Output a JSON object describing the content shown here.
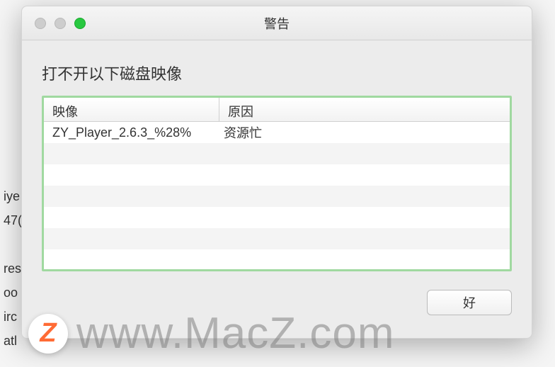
{
  "window": {
    "title": "警告"
  },
  "message": "打不开以下磁盘映像",
  "table": {
    "header": {
      "image": "映像",
      "reason": "原因"
    },
    "rows": [
      {
        "image": "ZY_Player_2.6.3_%28%",
        "reason": "资源忙"
      }
    ]
  },
  "buttons": {
    "ok": "好"
  },
  "watermark": {
    "logo": "Z",
    "text": "www.MacZ.com"
  },
  "background": {
    "line1": "iye",
    "line2": "47(",
    "line3": "res",
    "line4": "oo",
    "line5": "irc",
    "line6": "atl"
  }
}
